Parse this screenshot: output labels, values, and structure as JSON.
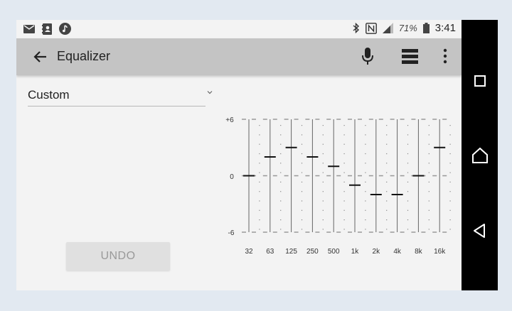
{
  "status": {
    "icons_left": [
      "mail-icon",
      "contacts-icon",
      "music-icon"
    ],
    "icons_right": [
      "bluetooth-icon",
      "nfc-icon",
      "signal-icon",
      "battery-icon"
    ],
    "battery": "71%",
    "time": "3:41"
  },
  "appbar": {
    "title": "Equalizer",
    "icons": [
      "back-arrow-icon",
      "mic-icon",
      "equalizer-bars-icon",
      "more-vert-icon"
    ]
  },
  "preset": {
    "label": "Custom"
  },
  "undo": {
    "label": "UNDO"
  },
  "equalizer": {
    "ymax_label": "+6",
    "ymid_label": "0",
    "ymin_label": "-6",
    "range_db": [
      -6,
      6
    ],
    "bands": [
      {
        "label": "32",
        "gain": 0
      },
      {
        "label": "63",
        "gain": 2
      },
      {
        "label": "125",
        "gain": 3
      },
      {
        "label": "250",
        "gain": 2
      },
      {
        "label": "500",
        "gain": 1
      },
      {
        "label": "1k",
        "gain": -1
      },
      {
        "label": "2k",
        "gain": -2
      },
      {
        "label": "4k",
        "gain": -2
      },
      {
        "label": "8k",
        "gain": 0
      },
      {
        "label": "16k",
        "gain": 3
      }
    ]
  },
  "navbar": {
    "icons": [
      "recents-icon",
      "home-icon",
      "back-icon"
    ]
  },
  "colors": {
    "appbar": "#c4c4c4",
    "background": "#f3f3f3",
    "navbar": "#000000"
  }
}
